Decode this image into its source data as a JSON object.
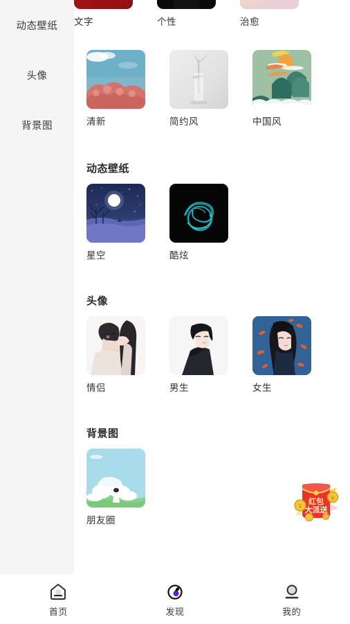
{
  "sidebar": {
    "items": [
      {
        "label": "动态壁纸",
        "name": "sidebar-item-dynamic-wallpaper"
      },
      {
        "label": "头像",
        "name": "sidebar-item-avatar"
      },
      {
        "label": "背景图",
        "name": "sidebar-item-background"
      }
    ]
  },
  "content": {
    "top_partial_row": {
      "items": [
        {
          "label": "文字",
          "thumb": "red-festive-text"
        },
        {
          "label": "个性",
          "thumb": "black-personality"
        },
        {
          "label": "治愈",
          "thumb": "pastel-healing"
        }
      ]
    },
    "wallpaper_row2": {
      "items": [
        {
          "label": "清新",
          "thumb": "cherry-blossom-sky"
        },
        {
          "label": "简约风",
          "thumb": "minimal-vase"
        },
        {
          "label": "中国风",
          "thumb": "chinese-mountain"
        }
      ]
    },
    "sections": [
      {
        "title": "动态壁纸",
        "name": "section-dynamic-wallpaper",
        "items": [
          {
            "label": "星空",
            "thumb": "starry-moon-night"
          },
          {
            "label": "酷炫",
            "thumb": "neon-swirl-dark"
          }
        ]
      },
      {
        "title": "头像",
        "name": "section-avatar",
        "items": [
          {
            "label": "情侣",
            "thumb": "couple-illustration"
          },
          {
            "label": "男生",
            "thumb": "boy-illustration"
          },
          {
            "label": "女生",
            "thumb": "girl-illustration"
          }
        ]
      },
      {
        "title": "背景图",
        "name": "section-background",
        "items": [
          {
            "label": "朋友圈",
            "thumb": "sky-cloud-girl"
          }
        ]
      }
    ]
  },
  "redpacket": {
    "line1": "红包",
    "line2": "大派送",
    "colors": {
      "envelope": "#e8342a",
      "coin": "#f7c92e",
      "text": "#fff3c4"
    }
  },
  "bottom_nav": {
    "items": [
      {
        "label": "首页",
        "icon": "home-icon",
        "active": false
      },
      {
        "label": "发现",
        "icon": "compass-icon",
        "active": true
      },
      {
        "label": "我的",
        "icon": "person-icon",
        "active": false
      }
    ],
    "accent": "#5b20e0"
  }
}
